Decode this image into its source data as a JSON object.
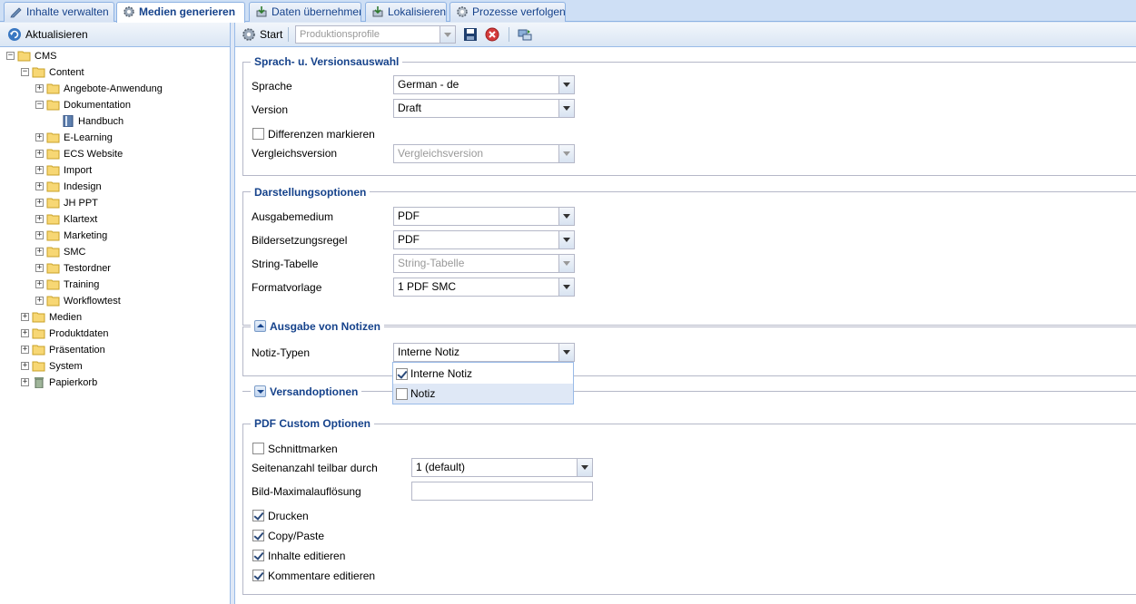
{
  "tabs": [
    {
      "label": "Inhalte verwalten",
      "icon": "pencil-icon"
    },
    {
      "label": "Medien generieren",
      "icon": "gear-icon",
      "active": true
    },
    {
      "label": "Daten übernehmen",
      "icon": "import-icon"
    },
    {
      "label": "Lokalisieren",
      "icon": "globe-icon"
    },
    {
      "label": "Prozesse verfolgen",
      "icon": "process-gear-icon"
    }
  ],
  "left_toolbar": {
    "refresh_label": "Aktualisieren"
  },
  "tree": [
    {
      "label": "CMS",
      "expanded": true
    },
    {
      "label": "Content",
      "expanded": true
    },
    {
      "label": "Angebote-Anwendung"
    },
    {
      "label": "Dokumentation",
      "expanded": true
    },
    {
      "label": "Handbuch",
      "icon": "book-icon"
    },
    {
      "label": "E-Learning"
    },
    {
      "label": "ECS Website"
    },
    {
      "label": "Import"
    },
    {
      "label": "Indesign"
    },
    {
      "label": "JH PPT"
    },
    {
      "label": "Klartext"
    },
    {
      "label": "Marketing"
    },
    {
      "label": "SMC"
    },
    {
      "label": "Testordner"
    },
    {
      "label": "Training"
    },
    {
      "label": "Workflowtest"
    },
    {
      "label": "Medien"
    },
    {
      "label": "Produktdaten"
    },
    {
      "label": "Präsentation"
    },
    {
      "label": "System"
    },
    {
      "label": "Papierkorb",
      "icon": "trash-icon"
    }
  ],
  "right_toolbar": {
    "start_label": "Start",
    "profile_placeholder": "Produktionsprofile"
  },
  "sections": {
    "sprache": {
      "title": "Sprach- u. Versionsauswahl",
      "sprache_label": "Sprache",
      "sprache_value": "German - de",
      "version_label": "Version",
      "version_value": "Draft",
      "diff_label": "Differenzen markieren",
      "diff_checked": false,
      "vergleich_label": "Vergleichsversion",
      "vergleich_value": "Vergleichsversion"
    },
    "darstellung": {
      "title": "Darstellungsoptionen",
      "ausgabe_label": "Ausgabemedium",
      "ausgabe_value": "PDF",
      "bild_label": "Bildersetzungsregel",
      "bild_value": "PDF",
      "string_label": "String-Tabelle",
      "string_value": "String-Tabelle",
      "format_label": "Formatvorlage",
      "format_value": "1 PDF SMC"
    },
    "notizen": {
      "title": "Ausgabe von Notizen",
      "typen_label": "Notiz-Typen",
      "typen_value": "Interne Notiz",
      "options": [
        {
          "label": "Interne Notiz",
          "checked": true
        },
        {
          "label": "Notiz",
          "checked": false
        }
      ]
    },
    "versand": {
      "title": "Versandoptionen"
    },
    "pdf": {
      "title": "PDF Custom Optionen",
      "schnitt_label": "Schnittmarken",
      "schnitt_checked": false,
      "seiten_label": "Seitenanzahl teilbar durch",
      "seiten_value": "1 (default)",
      "bild_label": "Bild-Maximalauflösung",
      "bild_value": "",
      "drucken_label": "Drucken",
      "copy_label": "Copy/Paste",
      "inhalte_label": "Inhalte editieren",
      "kommentare_label": "Kommentare editieren"
    }
  },
  "colors": {
    "accent": "#15428b",
    "panel_border": "#99bbe8",
    "background": "#dfe8f6"
  }
}
